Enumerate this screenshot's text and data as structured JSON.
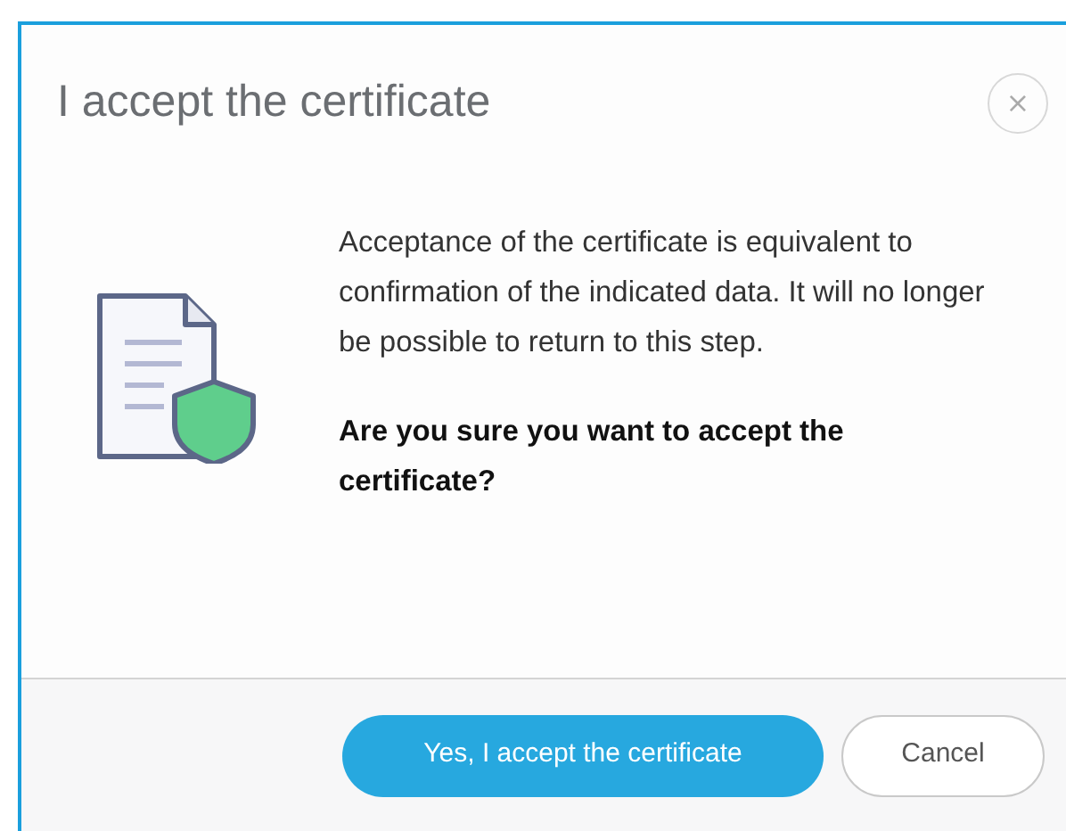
{
  "dialog": {
    "title": "I accept the certificate",
    "close_label": "×",
    "message": "Acceptance of the certificate is equivalent to confirmation of the indicated data. It will no longer be possible to return to this step.",
    "question": "Are you sure you want to accept the certificate?",
    "buttons": [
      {
        "label": "Yes, I accept the certificate",
        "kind": "primary"
      },
      {
        "label": "Cancel",
        "kind": "secondary"
      }
    ]
  }
}
